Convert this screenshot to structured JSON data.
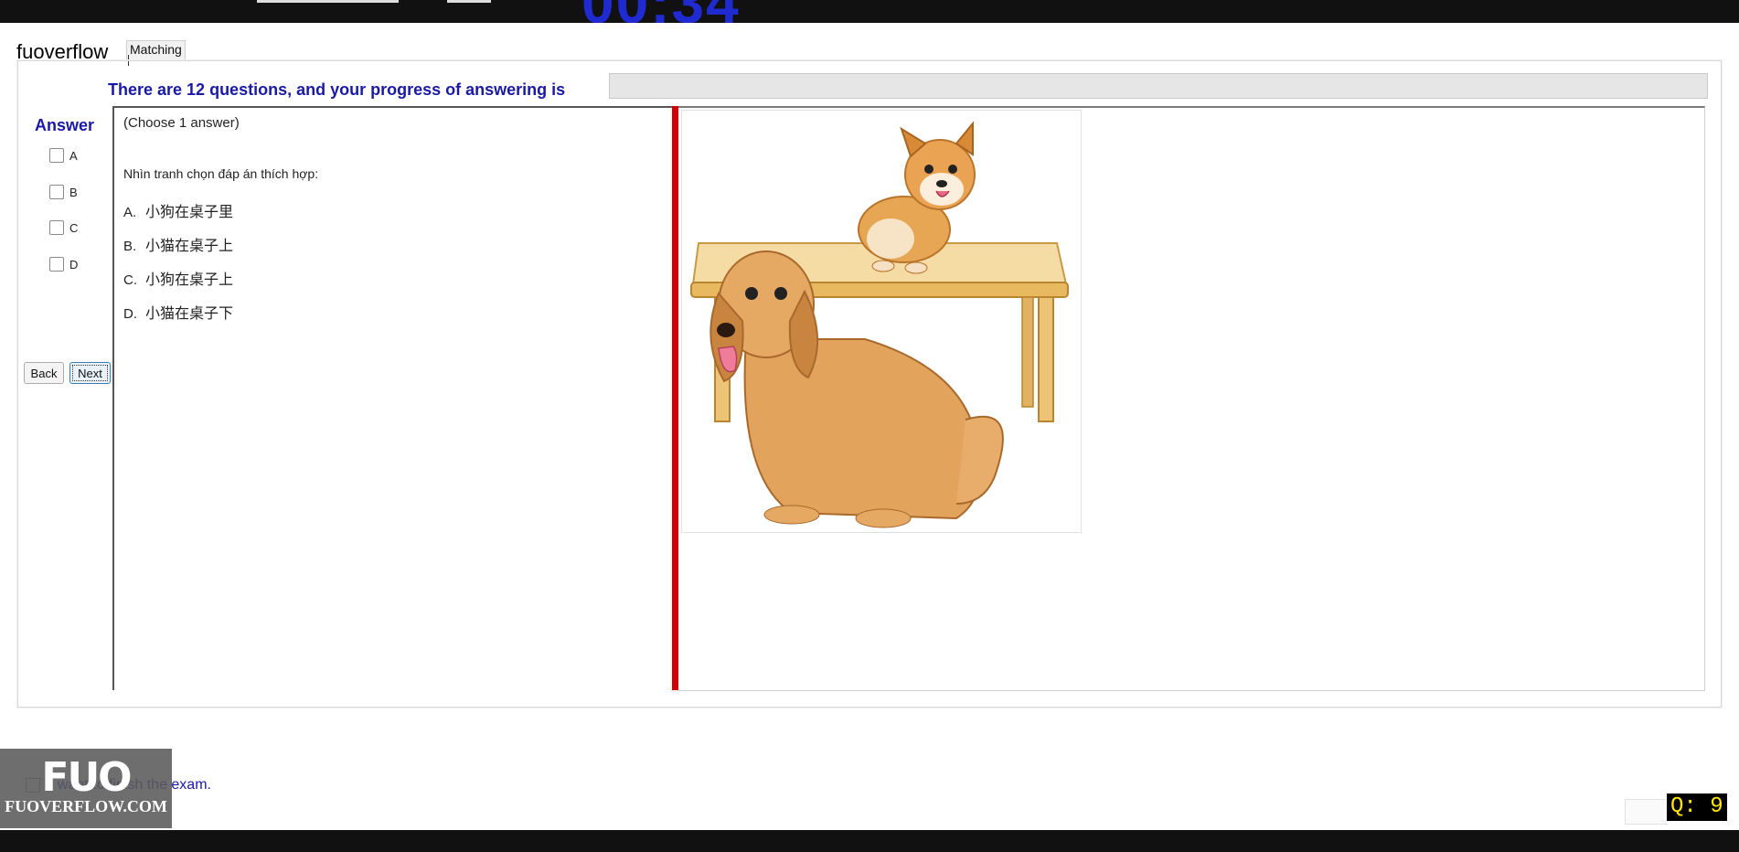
{
  "window": {
    "brand": "fuoverflow",
    "mode_tab": "Matching"
  },
  "progress": {
    "label": "There are 12 questions, and your progress of answering is",
    "total_questions": 12,
    "fraction": 0.0
  },
  "answer_panel": {
    "title": "Answer",
    "options": [
      {
        "label": "A"
      },
      {
        "label": "B"
      },
      {
        "label": "C"
      },
      {
        "label": "D"
      }
    ],
    "back_label": "Back",
    "next_label": "Next"
  },
  "question": {
    "hint": "(Choose 1 answer)",
    "prompt": "Nhìn tranh chọn đáp án thích hợp:",
    "choices": [
      {
        "letter": "A.",
        "text": "小狗在桌子里"
      },
      {
        "letter": "B.",
        "text": "小猫在桌子上"
      },
      {
        "letter": "C.",
        "text": "小狗在桌子上"
      },
      {
        "letter": "D.",
        "text": "小猫在桌子下"
      }
    ]
  },
  "finish": {
    "label": "I want to finish the exam."
  },
  "watermark": {
    "big": "FUO",
    "small": "FUOVERFLOW.COM"
  },
  "counter": {
    "text": "Q: 9"
  },
  "colors": {
    "accent_blue": "#1a1aa6",
    "splitter_red": "#d10000",
    "counter_yellow": "#ffe700"
  },
  "image": {
    "description_icon": "dogs-and-table-illustration"
  }
}
